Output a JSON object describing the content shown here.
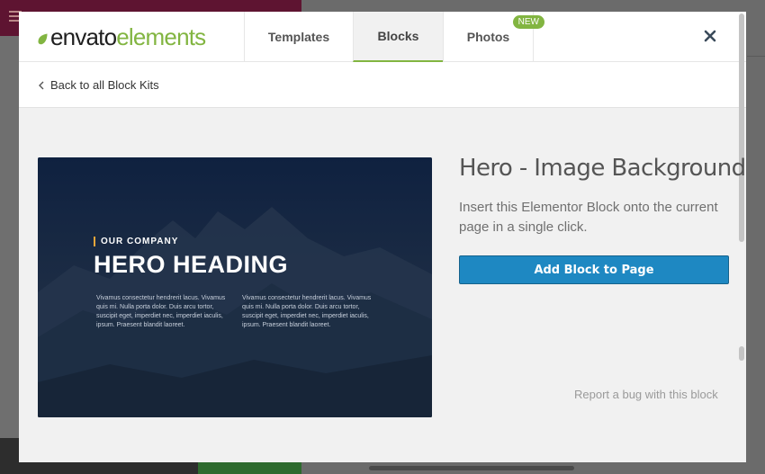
{
  "header": {
    "logo_part1": "envato",
    "logo_part2": "elements",
    "close_icon": "close-icon",
    "brand_color": "#82b541"
  },
  "tabs": [
    {
      "label": "Templates",
      "active": false
    },
    {
      "label": "Blocks",
      "active": true
    },
    {
      "label": "Photos",
      "active": false,
      "badge": "NEW"
    }
  ],
  "back": {
    "label": "Back to all Block Kits",
    "icon": "chevron-left-icon"
  },
  "preview": {
    "kicker": "OUR COMPANY",
    "heading": "HERO HEADING",
    "col1": "Vivamus consectetur hendrerit lacus. Vivamus quis mi. Nulla porta dolor. Duis arcu tortor, suscipit eget, imperdiet nec, imperdiet iaculis, ipsum. Praesent blandit laoreet.",
    "col2": "Vivamus consectetur hendrerit lacus. Vivamus quis mi. Nulla porta dolor. Duis arcu tortor, suscipit eget, imperdiet nec, imperdiet iaculis, ipsum. Praesent blandit laoreet."
  },
  "block": {
    "title": "Hero - Image Background",
    "description": "Insert this Elementor Block onto the current page in a single click.",
    "add_button": "Add Block to Page",
    "report_link": "Report a bug with this block",
    "button_color": "#1e88c2"
  }
}
